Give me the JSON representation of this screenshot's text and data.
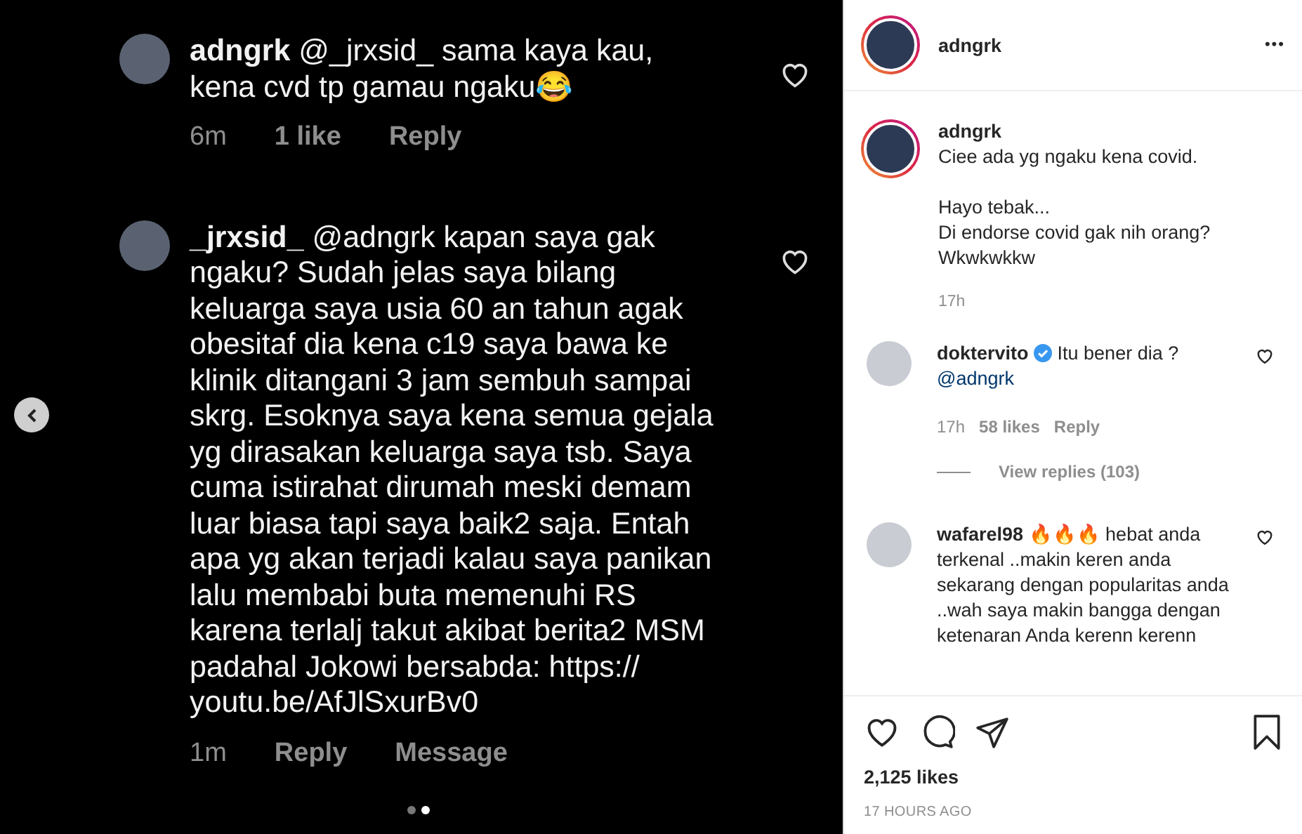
{
  "screenshot": {
    "comments": [
      {
        "username": "adngrk",
        "text": "@_jrxsid_ sama kaya kau, kena cvd tp gamau ngaku😂",
        "meta": [
          "6m",
          "1 like",
          "Reply"
        ]
      },
      {
        "username": "_jrxsid_",
        "text": "@adngrk kapan saya gak ngaku? Sudah jelas saya bilang keluarga saya usia 60 an tahun agak obesitaf dia kena c19 saya bawa ke klinik ditangani 3 jam sembuh sampai skrg. Esoknya saya kena semua gejala yg dirasakan keluarga saya tsb. Saya cuma istirahat dirumah meski demam luar biasa tapi saya baik2 saja. Entah apa yg akan terjadi kalau saya panikan lalu membabi buta memenuhi RS karena terlalj takut akibat berita2 MSM padahal Jokowi bersabda: https:// youtu.be/AfJlSxurBv0",
        "meta": [
          "1m",
          "Reply",
          "Message"
        ]
      }
    ],
    "dots": [
      {
        "selected": false
      },
      {
        "selected": true
      }
    ]
  },
  "header": {
    "username": "adngrk",
    "more": "•••"
  },
  "caption": {
    "username": "adngrk",
    "text": "Ciee ada yg ngaku kena covid.\n\nHayo tebak...\nDi endorse covid gak nih orang?\nWkwkwkkw",
    "time": "17h"
  },
  "comments": [
    {
      "username": "doktervito",
      "verified": true,
      "text": "Itu bener dia ?",
      "mention": "@adngrk",
      "meta": [
        "17h",
        "58 likes",
        "Reply"
      ],
      "view_replies": "View replies (103)"
    },
    {
      "username": "wafarel98",
      "verified": false,
      "text": "🔥🔥🔥 hebat anda terkenal ..makin keren anda sekarang dengan popularitas anda ..wah saya makin bangga dengan ketenaran Anda kerenn kerenn"
    }
  ],
  "likes": "2,125 likes",
  "posted": "17 HOURS AGO"
}
